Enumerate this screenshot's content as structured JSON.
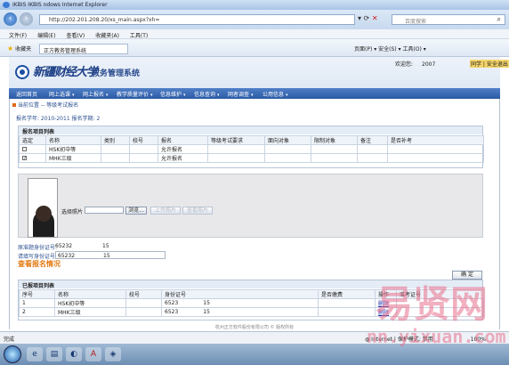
{
  "window": {
    "title": "IKBIS  IKBIS  ndows Internet Explorer"
  },
  "address": {
    "url": "http://202.201.208.20/xs_main.aspx?xh=",
    "search_placeholder": "百度搜索"
  },
  "menu": [
    "文件(F)",
    "编辑(E)",
    "查看(V)",
    "收藏夹(A)",
    "工具(T)"
  ],
  "favorites": {
    "label": "收藏夹",
    "tab": "正方教务管理系统",
    "tools": "页面(P) ▾  安全(S) ▾  工具(O) ▾"
  },
  "header": {
    "school": "新疆财经大学",
    "system": "教务管理系统",
    "welcome": "欢迎您:",
    "year": "2007",
    "links": "同学 | 安全退出"
  },
  "nav": [
    "返回首页",
    "网上选课",
    "网上报名",
    "教学质量评价",
    "信息维护",
    "信息查询",
    "网者调查",
    "公用信息"
  ],
  "breadcrumb": "当前位置 -- 等级考试报名",
  "term": {
    "label": "报名学年: 2010-2011  报名学期: 2"
  },
  "reg": {
    "title": "报名项目列表",
    "columns": [
      "选定",
      "名称",
      "类别",
      "校号",
      "报名",
      "等级考试要求",
      "面向对象",
      "限制对象",
      "备注",
      "是否补考"
    ],
    "rows": [
      {
        "checked": false,
        "name": "HSK初中等",
        "status": "允许报名"
      },
      {
        "checked": true,
        "name": "MHK三级",
        "status": "允许报名"
      }
    ]
  },
  "upload": {
    "label": "选择照片",
    "browse": "浏览...",
    "btn_upload": "上传照片",
    "btn_view": "查看照片"
  },
  "info": {
    "lines": [
      {
        "label": "原准题身份证号:",
        "value": "65232",
        "suffix": "15"
      },
      {
        "label": "请填写身份证号:",
        "value": "65232",
        "suffix": "15"
      }
    ],
    "view_link": "查看报名情况",
    "confirm": "确 定"
  },
  "done": {
    "title": "已报项目列表",
    "columns": [
      "序号",
      "名称",
      "校号",
      "身份证号",
      "是否缴费",
      "操作",
      "准考证号"
    ],
    "rows": [
      {
        "no": "1",
        "name": "HSK初中等",
        "id": "6523",
        "suffix": "15",
        "op": "删除"
      },
      {
        "no": "2",
        "name": "MHK三级",
        "id": "6523",
        "suffix": "15",
        "op": "删除"
      }
    ]
  },
  "footer": "杭州正方软件股份有限公司 © 版权所有",
  "status": {
    "left": "完成",
    "right": "Internet | 保护模式: 禁用",
    "zoom": "100%"
  },
  "watermark": {
    "top": "易贤网",
    "bottom": "nn.yixuan.com"
  }
}
